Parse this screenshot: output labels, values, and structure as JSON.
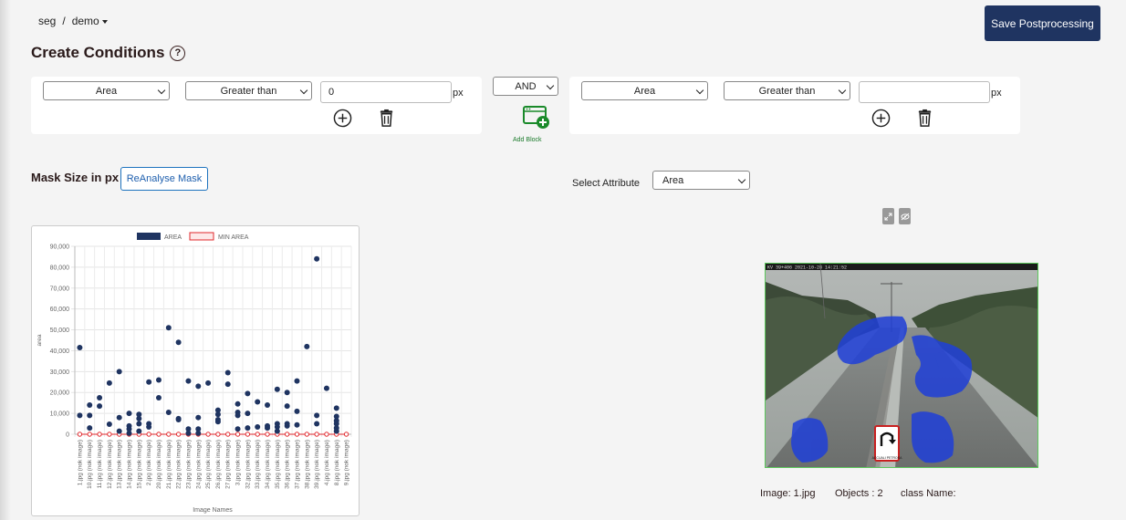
{
  "breadcrumb": {
    "project": "seg",
    "separator": "/",
    "dataset": "demo"
  },
  "toolbar": {
    "save_label": "Save Postprocessing"
  },
  "page": {
    "title": "Create Conditions",
    "help_glyph": "?"
  },
  "conditions": {
    "block1": {
      "attribute": "Area",
      "operator": "Greater than",
      "value": "0",
      "unit": "px"
    },
    "logic": "AND",
    "block2": {
      "attribute": "Area",
      "operator": "Greater than",
      "value": "",
      "unit": "px"
    },
    "add_block_label": "Add Block"
  },
  "mask": {
    "title": "Mask Size in px",
    "reanalyse_label": "ReAnalyse Mask"
  },
  "attribute_select": {
    "label": "Select Attribute",
    "value": "Area"
  },
  "chart_data": {
    "type": "scatter",
    "legend": [
      "AREA",
      "MIN AREA"
    ],
    "legend_position": "top",
    "ylabel": "area",
    "xlabel": "Image Names",
    "ylim": [
      0,
      90000
    ],
    "yticks": [
      0,
      10000,
      20000,
      30000,
      40000,
      50000,
      60000,
      70000,
      80000,
      90000
    ],
    "ytick_labels": [
      "0",
      "10,000",
      "20,000",
      "30,000",
      "40,000",
      "50,000",
      "60,000",
      "70,000",
      "80,000",
      "90,000"
    ],
    "grid": true,
    "colors": {
      "area": "#1f3461",
      "min_area": "#e0282d"
    },
    "categories": [
      "1.jpg (nok image)",
      "10.jpg (nok image)",
      "11.jpg (nok image)",
      "12.jpg (nok image)",
      "13.jpg (nok image)",
      "14.jpg (nok image)",
      "15.jpg (nok image)",
      "2.jpg (nok image)",
      "20.jpg (nok image)",
      "21.jpg (nok image)",
      "22.jpg (nok image)",
      "23.jpg (nok image)",
      "24.jpg (nok image)",
      "25.jpg (nok image)",
      "26.jpg (nok image)",
      "27.jpg (nok image)",
      "3.jpg (nok image)",
      "32.jpg (nok image)",
      "33.jpg (nok image)",
      "34.jpg (nok image)",
      "35.jpg (nok image)",
      "36.jpg (nok image)",
      "37.jpg (nok image)",
      "38.jpg (nok image)",
      "39.jpg (nok image)",
      "4.jpg (nok image)",
      "8.jpg (nok image)",
      "9.jpg (nok image)"
    ],
    "series": [
      {
        "name": "AREA",
        "points": [
          [
            0,
            41500
          ],
          [
            0,
            9000
          ],
          [
            1,
            14000
          ],
          [
            1,
            9000
          ],
          [
            1,
            3000
          ],
          [
            2,
            17500
          ],
          [
            2,
            13500
          ],
          [
            3,
            24500
          ],
          [
            3,
            4800
          ],
          [
            4,
            30000
          ],
          [
            4,
            8000
          ],
          [
            4,
            1500
          ],
          [
            5,
            10000
          ],
          [
            5,
            4000
          ],
          [
            5,
            2500
          ],
          [
            5,
            500
          ],
          [
            6,
            9500
          ],
          [
            6,
            7500
          ],
          [
            6,
            5000
          ],
          [
            6,
            1500
          ],
          [
            7,
            25000
          ],
          [
            7,
            5000
          ],
          [
            7,
            3500
          ],
          [
            8,
            26000
          ],
          [
            8,
            17500
          ],
          [
            9,
            51000
          ],
          [
            9,
            10500
          ],
          [
            10,
            44000
          ],
          [
            10,
            7500
          ],
          [
            10,
            7000
          ],
          [
            11,
            25500
          ],
          [
            11,
            2500
          ],
          [
            11,
            500
          ],
          [
            12,
            23000
          ],
          [
            12,
            8000
          ],
          [
            12,
            2500
          ],
          [
            12,
            500
          ],
          [
            13,
            24500
          ],
          [
            14,
            11500
          ],
          [
            14,
            9500
          ],
          [
            14,
            7000
          ],
          [
            14,
            6000
          ],
          [
            15,
            29500
          ],
          [
            15,
            24000
          ],
          [
            16,
            14500
          ],
          [
            16,
            10500
          ],
          [
            16,
            9000
          ],
          [
            16,
            2500
          ],
          [
            17,
            19500
          ],
          [
            17,
            10000
          ],
          [
            17,
            3000
          ],
          [
            18,
            15500
          ],
          [
            18,
            3500
          ],
          [
            19,
            14000
          ],
          [
            19,
            4000
          ],
          [
            19,
            3000
          ],
          [
            20,
            21500
          ],
          [
            20,
            5000
          ],
          [
            20,
            3500
          ],
          [
            20,
            1500
          ],
          [
            21,
            20000
          ],
          [
            21,
            13500
          ],
          [
            21,
            5000
          ],
          [
            21,
            4000
          ],
          [
            22,
            25500
          ],
          [
            22,
            11000
          ],
          [
            22,
            4500
          ],
          [
            23,
            42000
          ],
          [
            24,
            84000
          ],
          [
            24,
            9000
          ],
          [
            24,
            5000
          ],
          [
            25,
            22000
          ],
          [
            26,
            12500
          ],
          [
            26,
            8500
          ],
          [
            26,
            6500
          ],
          [
            26,
            5000
          ],
          [
            26,
            3000
          ],
          [
            26,
            1500
          ]
        ]
      },
      {
        "name": "MIN AREA",
        "values": [
          0,
          0,
          0,
          0,
          0,
          0,
          0,
          0,
          0,
          0,
          0,
          0,
          0,
          0,
          0,
          0,
          0,
          0,
          0,
          0,
          0,
          0,
          0,
          0,
          0,
          0,
          0,
          0
        ]
      }
    ]
  },
  "viewer": {
    "expand_icon": "expand-icon",
    "visibility_icon": "eye-off-icon",
    "camera_caption": "KV 39+406 2021-10-28 14:21:52",
    "sign_text": "ACCUALI PETROSA",
    "image_label": "Image: 1.jpg",
    "objects_label": "Objects : 2",
    "class_label": "class Name:"
  }
}
